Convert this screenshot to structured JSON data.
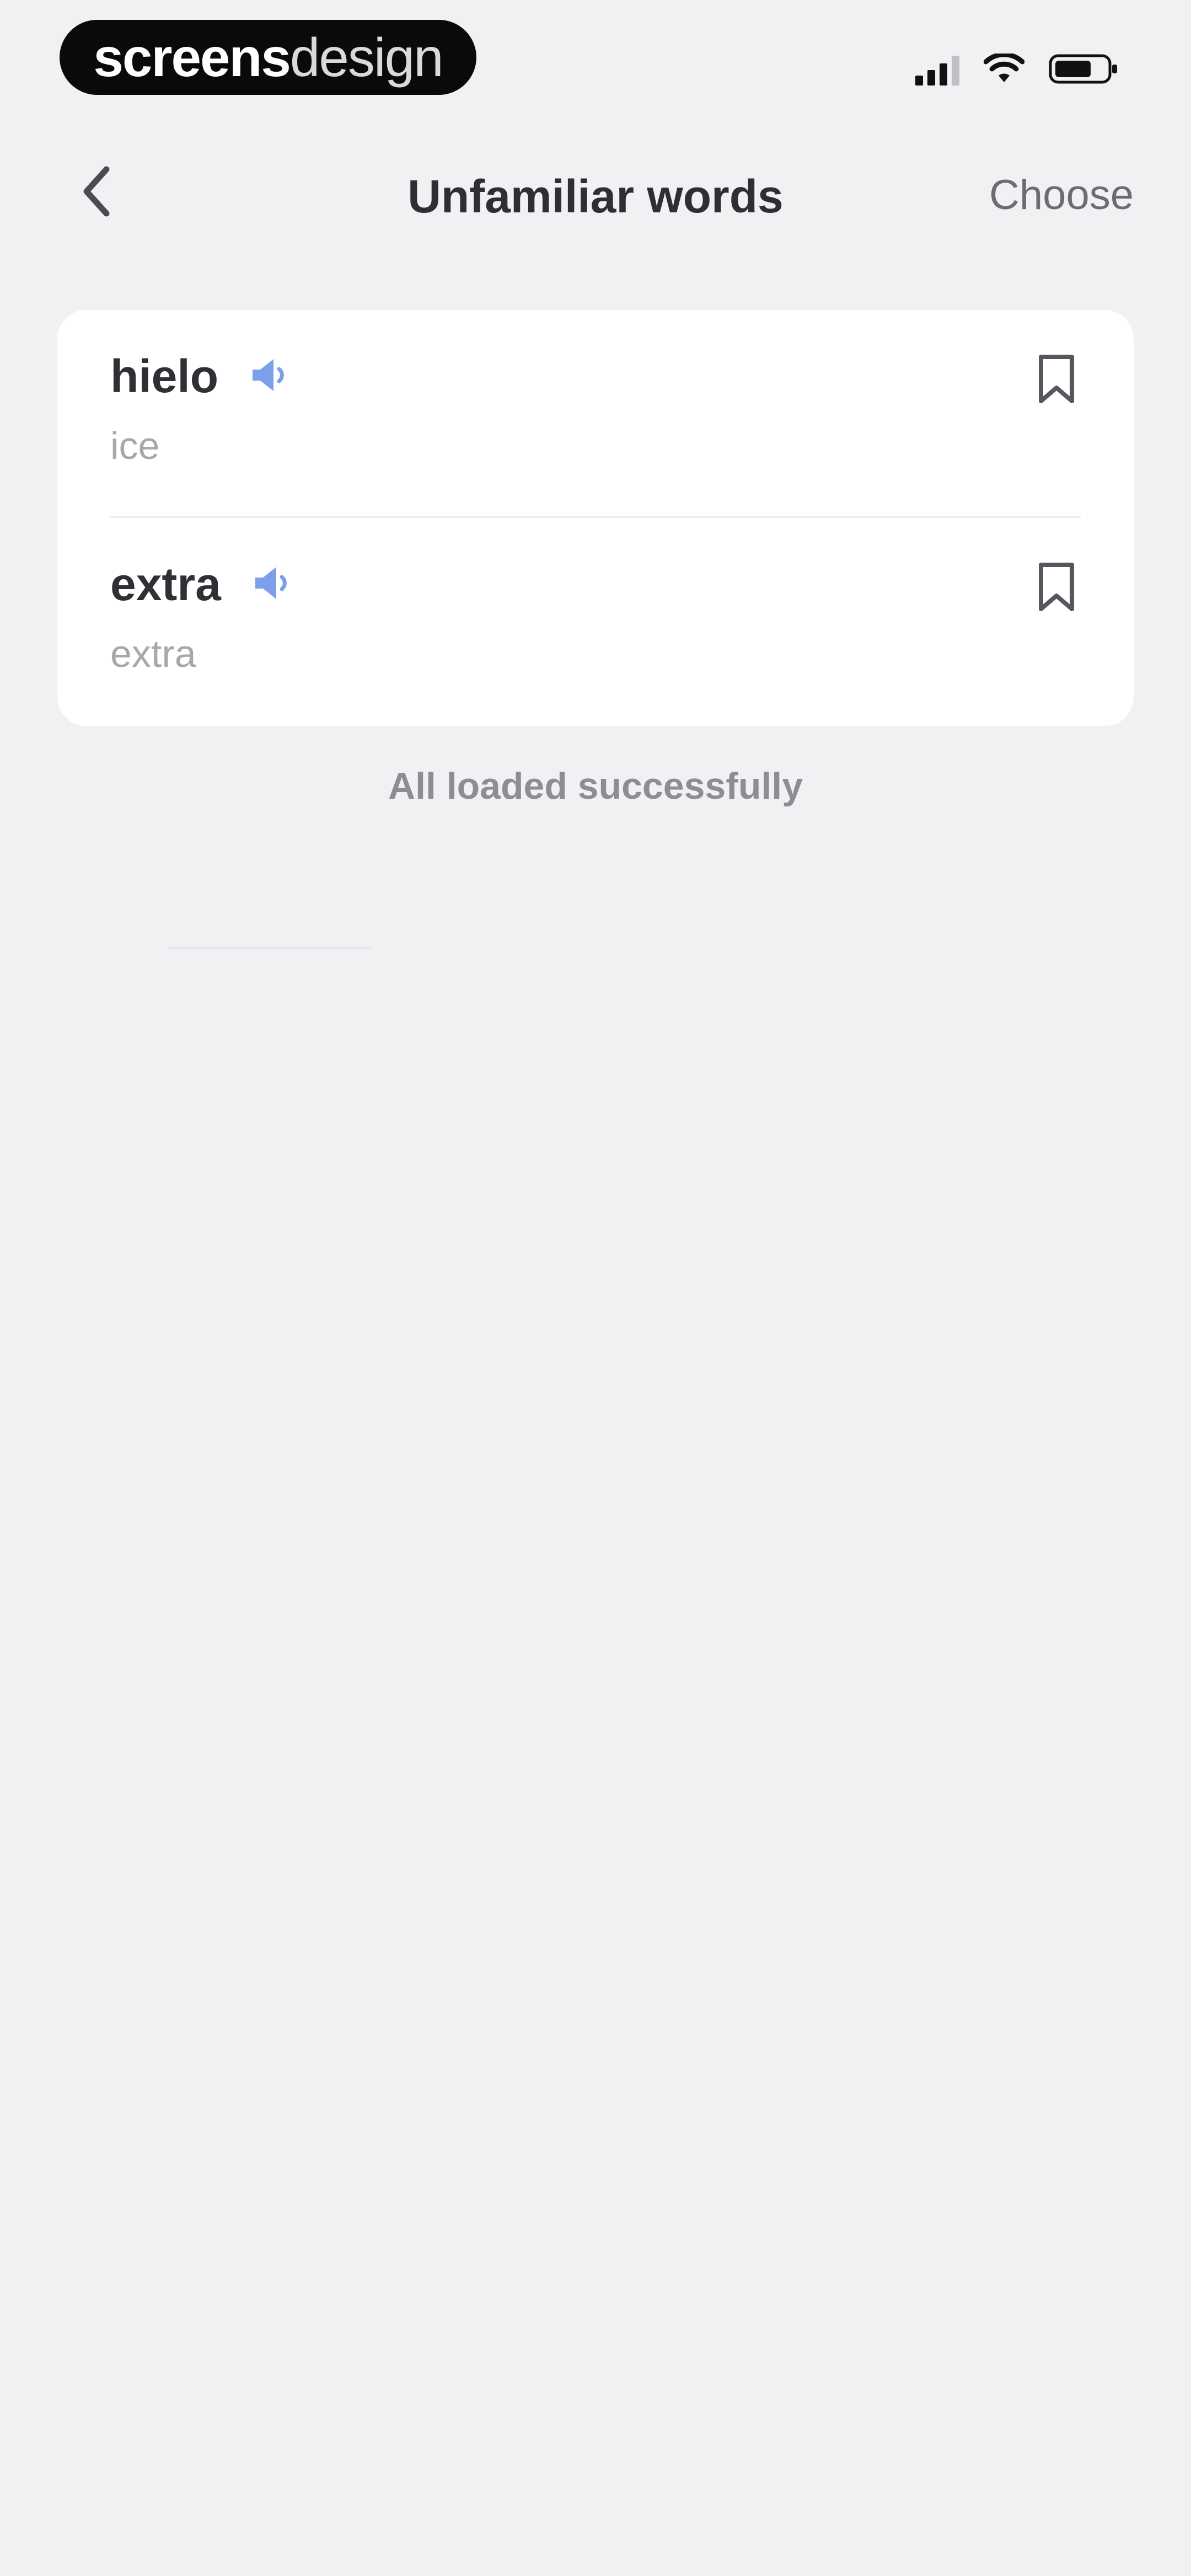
{
  "status_bar": {
    "brand_bold": "screens",
    "brand_light": "design"
  },
  "nav": {
    "title": "Unfamiliar words",
    "action": "Choose"
  },
  "words": [
    {
      "word": "hielo",
      "translation": "ice"
    },
    {
      "word": "extra",
      "translation": "extra"
    }
  ],
  "load_status": "All loaded successfully",
  "icons": {
    "back": "chevron-left-icon",
    "speaker": "speaker-icon",
    "bookmark": "bookmark-icon",
    "signal": "signal-icon",
    "wifi": "wifi-icon",
    "battery": "battery-icon"
  },
  "colors": {
    "background": "#f0f1f3",
    "card": "#ffffff",
    "speaker_accent": "#7b9fe9",
    "title_text": "#2e2f33",
    "secondary_text": "#a6a8ad"
  }
}
